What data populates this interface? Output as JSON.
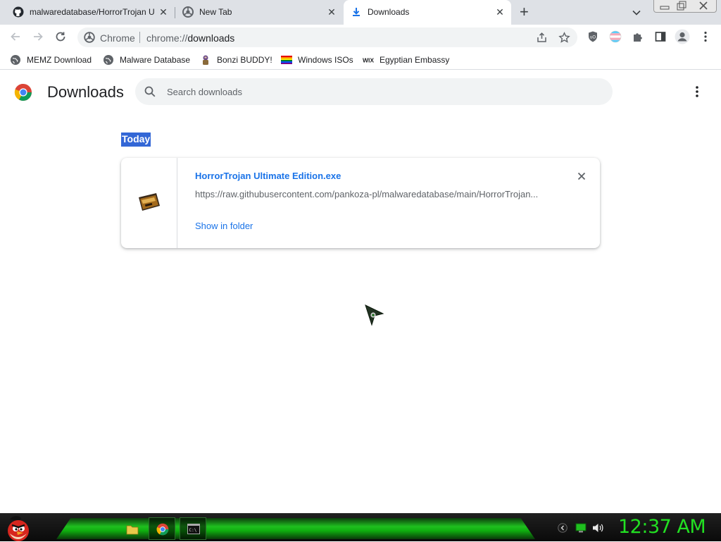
{
  "tabs": [
    {
      "label": "malwaredatabase/HorrorTrojan Ul",
      "icon": "github-icon",
      "active": false
    },
    {
      "label": "New Tab",
      "icon": "chrome-page-icon",
      "active": false
    },
    {
      "label": "Downloads",
      "icon": "download-icon",
      "active": true
    }
  ],
  "toolbar": {
    "site_chip": "Chrome",
    "url_scheme": "chrome://",
    "url_host": "downloads"
  },
  "bookmarks": [
    {
      "label": "MEMZ Download",
      "icon": "globe-icon"
    },
    {
      "label": "Malware Database",
      "icon": "globe-icon"
    },
    {
      "label": "Bonzi BUDDY!",
      "icon": "bonzi-icon"
    },
    {
      "label": "Windows ISOs",
      "icon": "rainbow-flag-icon"
    },
    {
      "label": "Egyptian Embassy",
      "icon": "wix-icon"
    }
  ],
  "page": {
    "title": "Downloads",
    "search_placeholder": "Search downloads",
    "section": "Today"
  },
  "download": {
    "filename": "HorrorTrojan Ultimate Edition.exe",
    "url": "https://raw.githubusercontent.com/pankoza-pl/malwaredatabase/main/HorrorTrojan...",
    "action": "Show in folder"
  },
  "taskbar": {
    "clock": "12:37 AM",
    "accent": "#1fbf1f"
  }
}
